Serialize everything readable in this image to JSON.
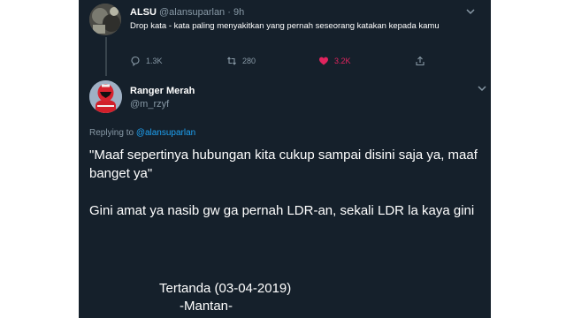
{
  "tweet": {
    "display_name": "ALSU",
    "handle": "@alansuparlan",
    "separator": "·",
    "time": "9h",
    "text": "Drop kata - kata paling menyakitkan yang pernah seseorang katakan kepada kamu",
    "reply_count": "1.3K",
    "retweet_count": "280",
    "like_count": "3.2K"
  },
  "reply": {
    "display_name": "Ranger Merah",
    "handle": "@m_rzyf",
    "replying_prefix": "Replying to",
    "replying_to": "@alansuparlan",
    "paragraph1": "\"Maaf sepertinya hubungan kita cukup sampai disini saja ya, maaf banget ya\"",
    "paragraph2": "Gini amat ya nasib gw ga pernah LDR-an,  sekali LDR la kaya gini",
    "signature_line1": "Tertanda  (03-04-2019)",
    "signature_line2": "-Mantan-"
  },
  "colors": {
    "background": "#15202b",
    "text": "#ffffff",
    "muted": "#8899a6",
    "link": "#1da1f2",
    "like": "#e0245e",
    "thread_line": "#38444d"
  },
  "icons": {
    "reply": "reply-icon",
    "retweet": "retweet-icon",
    "like": "heart-icon",
    "share": "share-icon",
    "more": "chevron-down-icon"
  }
}
